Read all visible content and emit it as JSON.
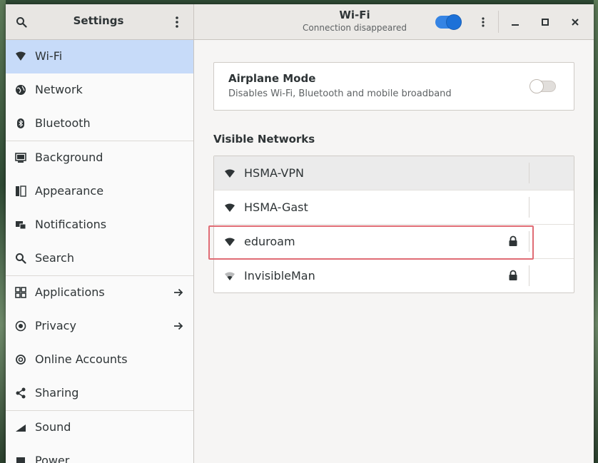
{
  "header": {
    "sidebar_title": "Settings",
    "title": "Wi-Fi",
    "subtitle": "Connection disappeared",
    "wifi_enabled": true
  },
  "sidebar": {
    "items": [
      {
        "label": "Wi-Fi",
        "icon": "wifi-icon",
        "active": true
      },
      {
        "label": "Network",
        "icon": "network-icon"
      },
      {
        "label": "Bluetooth",
        "icon": "bluetooth-icon"
      },
      {
        "label": "Background",
        "icon": "background-icon"
      },
      {
        "label": "Appearance",
        "icon": "appearance-icon"
      },
      {
        "label": "Notifications",
        "icon": "notifications-icon"
      },
      {
        "label": "Search",
        "icon": "search-icon"
      },
      {
        "label": "Applications",
        "icon": "applications-icon",
        "arrow": true
      },
      {
        "label": "Privacy",
        "icon": "privacy-icon",
        "arrow": true
      },
      {
        "label": "Online Accounts",
        "icon": "online-accounts-icon"
      },
      {
        "label": "Sharing",
        "icon": "sharing-icon"
      },
      {
        "label": "Sound",
        "icon": "sound-icon"
      },
      {
        "label": "Power",
        "icon": "power-icon"
      }
    ]
  },
  "airplane": {
    "title": "Airplane Mode",
    "subtitle": "Disables Wi-Fi, Bluetooth and mobile broadband",
    "enabled": false
  },
  "networks": {
    "title": "Visible Networks",
    "items": [
      {
        "name": "HSMA-VPN",
        "locked": false,
        "signal": "strong"
      },
      {
        "name": "HSMA-Gast",
        "locked": false,
        "signal": "strong"
      },
      {
        "name": "eduroam",
        "locked": true,
        "signal": "strong",
        "highlighted": true
      },
      {
        "name": "InvisibleMan",
        "locked": true,
        "signal": "weak"
      }
    ]
  },
  "colors": {
    "accent": "#3584e4",
    "active_row": "#c7dbf9",
    "highlight": "#e06c75"
  }
}
